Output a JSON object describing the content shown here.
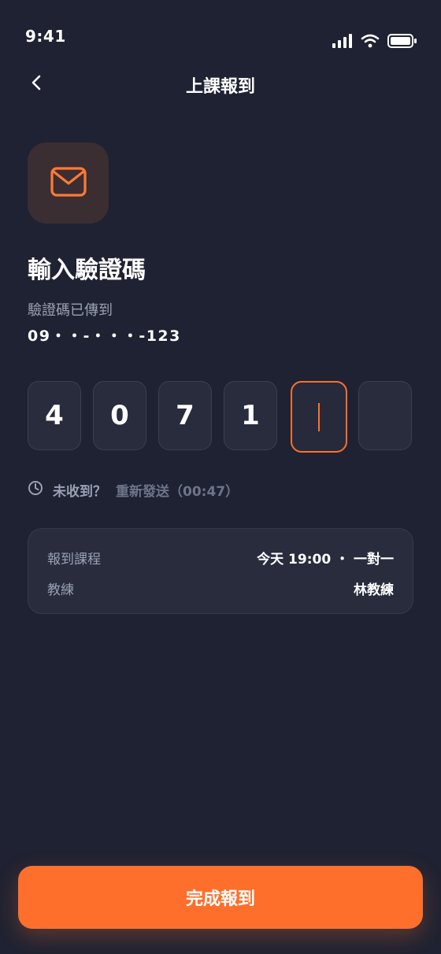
{
  "status_bar": {
    "time": "9:41"
  },
  "nav": {
    "title": "上課報到"
  },
  "verify": {
    "heading": "輸入驗證碼",
    "sent_to_label": "驗證碼已傳到",
    "phone_masked": "09・・-・・・-123"
  },
  "otp": {
    "digits": [
      "4",
      "0",
      "7",
      "1",
      "",
      ""
    ],
    "active_index": 4
  },
  "resend": {
    "question": "未收到？",
    "link": "重新發送（00:47）"
  },
  "course_card": {
    "rows": [
      {
        "label": "報到課程",
        "value": "今天 19:00 ・ 一對一"
      },
      {
        "label": "教練",
        "value": "林教練"
      }
    ]
  },
  "submit": {
    "label": "完成報到"
  },
  "colors": {
    "background": "#1f2232",
    "accent": "#ff6f2c",
    "card": "#282c3d",
    "muted_text": "#9aa0b4"
  },
  "icons": {
    "back": "chevron-left-icon",
    "mail": "mail-icon",
    "clock": "clock-icon",
    "signal": "signal-icon",
    "wifi": "wifi-icon",
    "battery": "battery-icon"
  }
}
